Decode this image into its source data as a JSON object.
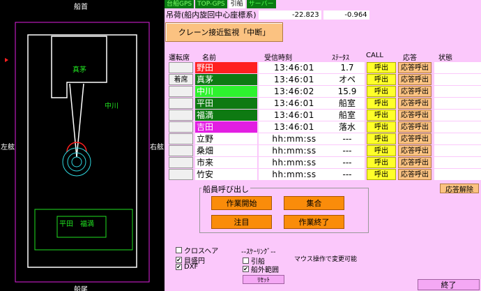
{
  "radar": {
    "label_bow": "船首",
    "label_stern": "船尾",
    "label_port": "左舷",
    "label_starboard": "右舷",
    "name_block": "真茅",
    "name_side": "中川",
    "name_lower": "平田　福満"
  },
  "topbar": {
    "items": [
      "台船GPS",
      "TOP-GPS",
      "引船",
      "サーバー"
    ]
  },
  "coords": {
    "label": "吊荷(船内旋回中心座標系)",
    "x": "-22.823",
    "y": "-0.964"
  },
  "crane_button": "クレーン接近監視「中断」",
  "headers": {
    "button": "運転席",
    "name": "名前",
    "time": "受信時刻",
    "status": "ｽﾃｰﾀｽ",
    "call": "CALL",
    "response": "応答",
    "state": "状態"
  },
  "rows": [
    {
      "btn": "",
      "name": "野田",
      "color": "#ff2020",
      "time": "13:46:01",
      "status": "1.7",
      "call": "呼出",
      "resp": "応答呼出"
    },
    {
      "btn": "着席",
      "name": "真茅",
      "color": "#0e7a12",
      "time": "13:46:01",
      "status": "オペ",
      "call": "呼出",
      "resp": "応答呼出"
    },
    {
      "btn": "",
      "name": "中川",
      "color": "#2ef22e",
      "time": "13:46:02",
      "status": "15.9",
      "call": "呼出",
      "resp": "応答呼出"
    },
    {
      "btn": "",
      "name": "平田",
      "color": "#0e7a12",
      "time": "13:46:01",
      "status": "船室",
      "call": "呼出",
      "resp": "応答呼出"
    },
    {
      "btn": "",
      "name": "福満",
      "color": "#0e7a12",
      "time": "13:46:01",
      "status": "船室",
      "call": "呼出",
      "resp": "応答呼出"
    },
    {
      "btn": "",
      "name": "吉田",
      "color": "#e21ee2",
      "time": "13:46:01",
      "status": "落水",
      "call": "呼出",
      "resp": "応答呼出"
    },
    {
      "btn": "",
      "name": "立野",
      "color": "",
      "time": "hh:mm:ss",
      "status": "---",
      "call": "呼出",
      "resp": "応答呼出"
    },
    {
      "btn": "",
      "name": "桑畑",
      "color": "",
      "time": "hh:mm:ss",
      "status": "---",
      "call": "呼出",
      "resp": "応答呼出"
    },
    {
      "btn": "",
      "name": "市来",
      "color": "",
      "time": "hh:mm:ss",
      "status": "---",
      "call": "呼出",
      "resp": "応答呼出"
    },
    {
      "btn": "",
      "name": "竹安",
      "color": "",
      "time": "hh:mm:ss",
      "status": "---",
      "call": "呼出",
      "resp": "応答呼出"
    }
  ],
  "response_clear": "応答解除",
  "crew_call": {
    "title": "船員呼び出し",
    "start": "作業開始",
    "gather": "集合",
    "attention": "注目",
    "finish": "作業終了"
  },
  "options": {
    "crosshair": "クロスヘア",
    "scale_circle": "目盛円",
    "dxf": "DXF",
    "scaling_title": "--ｽｹｰﾘﾝｸﾞ--",
    "tug": "引船",
    "outboard": "船外範囲",
    "mouse_note": "マウス操作で変更可能",
    "reset": "ﾘｾｯﾄ",
    "end": "終了"
  }
}
